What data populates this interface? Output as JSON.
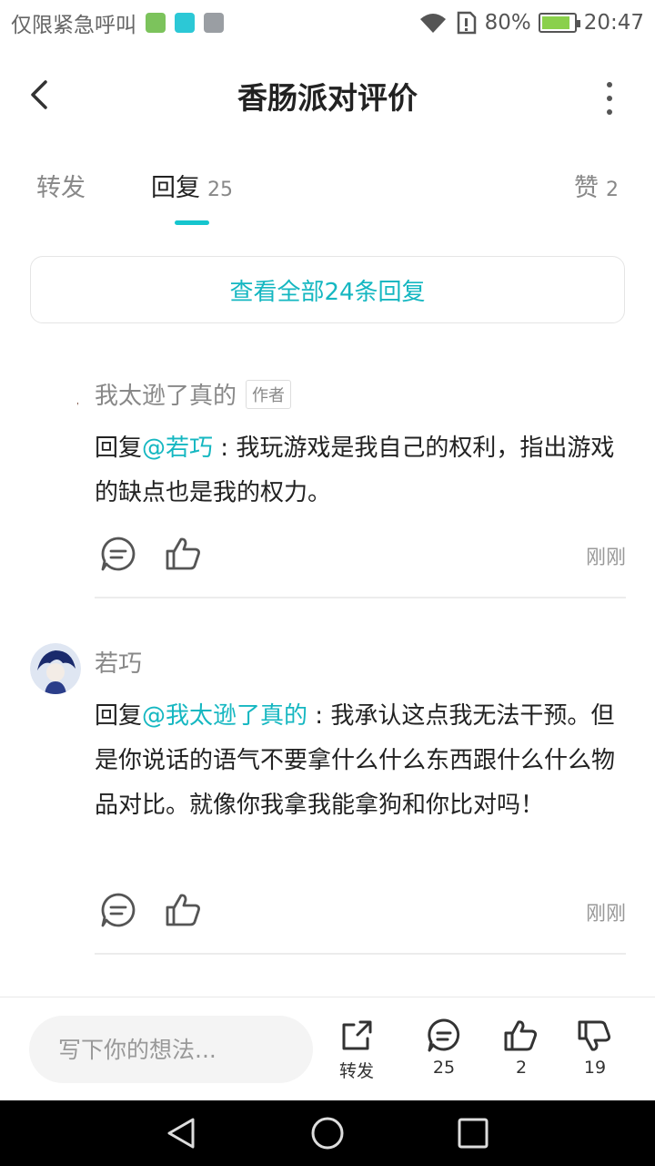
{
  "status_bar": {
    "carrier": "仅限紧急呼叫",
    "battery": "80%",
    "time": "20:47"
  },
  "header": {
    "title": "香肠派对评价"
  },
  "tabs": [
    {
      "label": "转发",
      "count": ""
    },
    {
      "label": "回复",
      "count": "25"
    },
    {
      "label": "赞",
      "count": "2"
    }
  ],
  "view_all_label": "查看全部24条回复",
  "comments": [
    {
      "user": "我太逊了真的",
      "badge": "作者",
      "reply_prefix": "回复",
      "mention": "@若巧",
      "text": " : 我玩游戏是我自己的权利，指出游戏的缺点也是我的权力。",
      "time": "刚刚"
    },
    {
      "user": "若巧",
      "badge": "",
      "reply_prefix": "回复",
      "mention": "@我太逊了真的",
      "text": " : 我承认这点我无法干预。但是你说话的语气不要拿什么什么东西跟什么什么物品对比。就像你我拿我能拿狗和你比对吗！",
      "time": "刚刚"
    }
  ],
  "bottom_bar": {
    "input_placeholder": "写下你的想法...",
    "repost_label": "转发",
    "comment_count": "25",
    "like_count": "2",
    "dislike_count": "19"
  },
  "colors": {
    "accent": "#15b7c1",
    "text": "#222222",
    "muted": "#888888"
  }
}
